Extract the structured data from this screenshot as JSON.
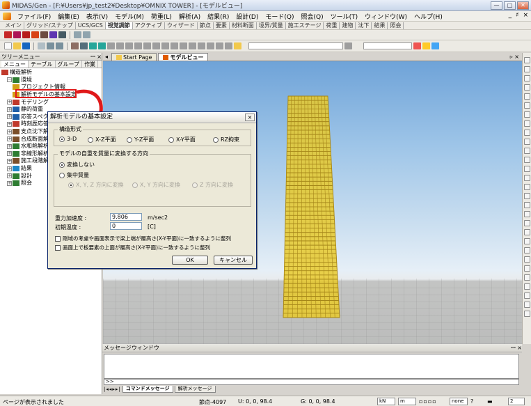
{
  "window": {
    "title": "MIDAS/Gen - [F:¥Users¥jp_test2¥Desktop¥OMNIX TOWER] - [モデルビュー]",
    "buttons": [
      "—",
      "□",
      "✕"
    ]
  },
  "menu": {
    "items": [
      "ファイル(F)",
      "編集(E)",
      "表示(V)",
      "モデル(M)",
      "荷重(L)",
      "解析(A)",
      "結果(R)",
      "設計(D)",
      "モード(Q)",
      "照会(Q)",
      "ツール(T)",
      "ウィンドウ(W)",
      "ヘルプ(H)"
    ],
    "right_controls": [
      "_",
      "♯",
      "×"
    ]
  },
  "tabs": [
    "メイン",
    "グリッド/スナップ",
    "UCS/GCS",
    "視覚調節",
    "アクティブ",
    "ウィザード",
    "節点",
    "要素",
    "材料断面",
    "境界/質量",
    "施工ステージ",
    "荷重",
    "建物",
    "沈下",
    "結果",
    "照会"
  ],
  "active_tab": "視覚調節",
  "left_panel": {
    "header": "ツリーメニュー",
    "pin": "ꟷ ×",
    "tabs": [
      "メニュー",
      "テーブル",
      "グループ",
      "作業"
    ],
    "tree": [
      {
        "label": "構造解析",
        "level": 0,
        "expander": "",
        "icon_color": "#c0392b"
      },
      {
        "label": "環境",
        "level": 1,
        "expander": "−",
        "icon_color": "#2e7d32"
      },
      {
        "label": "プロジェクト情報",
        "level": 2,
        "expander": "",
        "icon_color": "#d4a017"
      },
      {
        "label": "解析モデルの基本設定",
        "level": 2,
        "expander": "",
        "icon_color": "#d4a017"
      },
      {
        "label": "モデリング",
        "level": 1,
        "expander": "+",
        "icon_color": "#c0392b"
      },
      {
        "label": "静的荷重",
        "level": 1,
        "expander": "+",
        "icon_color": "#1f5fa8"
      },
      {
        "label": "応答スペクトル",
        "level": 1,
        "expander": "+",
        "icon_color": "#1f5fa8"
      },
      {
        "label": "時刻歴応答",
        "level": 1,
        "expander": "+",
        "icon_color": "#c0392b"
      },
      {
        "label": "支点沈下解析",
        "level": 1,
        "expander": "+",
        "icon_color": "#7b4f2a"
      },
      {
        "label": "合成断面解析",
        "level": 1,
        "expander": "+",
        "icon_color": "#7b4f2a"
      },
      {
        "label": "水和熱解析",
        "level": 1,
        "expander": "+",
        "icon_color": "#2e7d32"
      },
      {
        "label": "非線形解析",
        "level": 1,
        "expander": "+",
        "icon_color": "#2e7d32"
      },
      {
        "label": "施工段階解析",
        "level": 1,
        "expander": "+",
        "icon_color": "#7b4f2a"
      },
      {
        "label": "結果",
        "level": 1,
        "expander": "+",
        "icon_color": "#1e88c8"
      },
      {
        "label": "設計",
        "level": 1,
        "expander": "+",
        "icon_color": "#2e7d32"
      },
      {
        "label": "照会",
        "level": 1,
        "expander": "+",
        "icon_color": "#2e7d32"
      }
    ]
  },
  "view_tabs": [
    {
      "label": "Start Page",
      "active": false
    },
    {
      "label": "モデルビュー",
      "active": true
    }
  ],
  "dialog": {
    "title": "解析モデルの基本設定",
    "close": "×",
    "structure_group": "構造形式",
    "structure_options": [
      {
        "label": "3-D",
        "checked": true
      },
      {
        "label": "X-Z平面",
        "checked": false
      },
      {
        "label": "Y-Z平面",
        "checked": false
      },
      {
        "label": "X-Y平面",
        "checked": false
      },
      {
        "label": "RZ拘束",
        "checked": false
      }
    ],
    "mass_group": "モデルの自重を質量に変換する方向",
    "mass_options": [
      {
        "label": "変換しない",
        "checked": true
      },
      {
        "label": "集中質量",
        "checked": false
      }
    ],
    "mass_sub_options": [
      "X, Y, Z 方向に変換",
      "X, Y 方向に変換",
      "Z 方向に変換"
    ],
    "gravity_label": "重力加速度 :",
    "gravity_value": "9.806",
    "gravity_unit": "m/sec2",
    "temp_label": "初期温度 :",
    "temp_value": "0",
    "temp_unit": "[C]",
    "check1": "剛域の考慮や画面表示で梁上端が層高さ(X-Y平面)に一致するように整列",
    "check2": "画面上で板要素の上面が層高さ(X-Y平面)に一致するように整列",
    "ok": "OK",
    "cancel": "キャンセル"
  },
  "message_window": {
    "title": "メッセージウィンドウ",
    "pin": "ꟷ ×",
    "prompt": ">>",
    "tabs": [
      {
        "label": "コマンドメッセージ",
        "active": true
      },
      {
        "label": "解析メッセージ",
        "active": false
      }
    ]
  },
  "status": {
    "message": "ページが表示されました",
    "node": "節点-4097",
    "ucs": "U: 0, 0, 98.4",
    "gcs": "G: 0, 0, 98.4",
    "force_unit": "kN",
    "length_unit": "m",
    "snap": "none",
    "page_of": "2"
  },
  "colors": {
    "tower": "#e8c92a",
    "highlight": "#e0191a",
    "sky_top": "#6fa3d8"
  }
}
